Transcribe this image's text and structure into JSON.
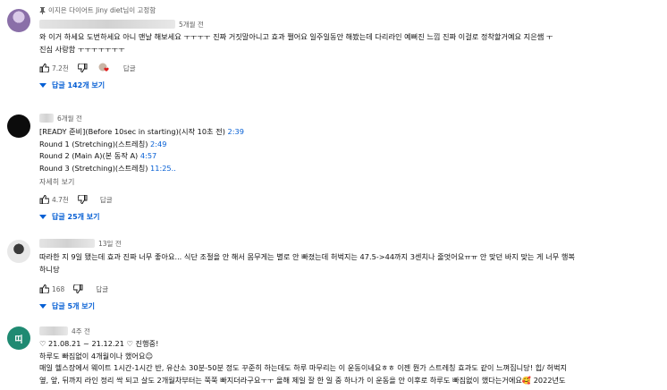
{
  "comments": [
    {
      "pinned_text": "이지은 다이어트 Jiny diet님이 고정함",
      "time": "5개월 전",
      "lines": [
        "와 이거 하세요 도번하세요 아니 맨날 해보세요 ㅜㅜㅜㅜ 진짜 거짓말아니고 효과 쩔어요 일주일동안 해봤는데 다리라인 예뻐진 느낌 진짜 이걸로 정착할거예요 지은쌤 ㅜ",
        "진심 사랑함 ㅜㅜㅜㅜㅜㅜㅜ"
      ],
      "likes": "7.2천",
      "reply_label": "답글",
      "replies_label": "답글 142개 보기"
    },
    {
      "time": "6개월 전",
      "lines": [
        {
          "text": "[READY 준비](Before 10sec in starting)(시작 10초 전) ",
          "ts": "2:39"
        },
        {
          "text": "Round 1 (Stretching)(스트레칭) ",
          "ts": "2:49"
        },
        {
          "text": "Round 2 (Main A)(본 동작 A) ",
          "ts": "4:57"
        },
        {
          "text": "Round 3 (Stretching)(스트레칭) ",
          "ts": "11:25.."
        }
      ],
      "more_label": "자세히 보기",
      "likes": "4.7천",
      "reply_label": "답글",
      "replies_label": "답글 25개 보기"
    },
    {
      "time": "13일 전",
      "lines": [
        "따라한 지 9일 됐는데 효과 진짜 너무 좋아요... 식단 조절을 안 해서 몸무게는 별로 안 빠졌는데 허벅지는 47.5->44까지 3센치나 줄엇어요ㅠㅠ 안 맞던 바지 맞는 게 너무 행복",
        "하니당"
      ],
      "likes": "168",
      "reply_label": "답글",
      "replies_label": "답글 5개 보기"
    },
    {
      "avatar_letter": "띠",
      "time": "4주 전",
      "lines": [
        "♡ 21.08.21 ~ 21.12.21 ♡ 진행중!",
        "하루도 빠짐없이 4개월이나 했어요☺",
        "매일 헬스장에서 웨이트 1시간-1시간 반, 유산소 30분-50분 정도 꾸준히 하는데도 하루 마무리는 이 운동이네요ㅎㅎ 이젠 뭔가 스트레칭 효과도 같이 느껴집니당! 힙/ 허벅지",
        "옆, 앞, 뒤까지 라인 정리 싹 되고 살도 2개월차부터는 쭉쭉 빠지더라구요ㅜㅜ 올해 제일 잘 한 일 중 하나가 이 운동을 안 이후로 하루도 빠짐없이 했다는거에요🥰 2022년도"
      ]
    }
  ]
}
